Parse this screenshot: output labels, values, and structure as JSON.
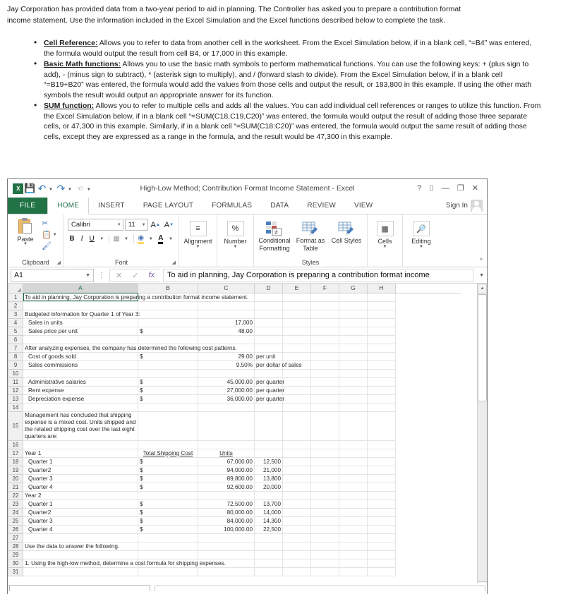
{
  "intro": {
    "p1": "Jay Corporation has provided data from a two-year period to aid in planning.  The Controller has asked you to prepare a contribution format",
    "p2": "income statement.  Use the information included in the Excel Simulation and the Excel functions described below to complete the task."
  },
  "bullets": [
    {
      "term": "Cell Reference:",
      "text": " Allows you to refer to data from another cell in the worksheet.  From the Excel Simulation below, if in a blank cell, “=B4” was entered, the formula would output the result from cell B4, or 17,000 in this example."
    },
    {
      "term": "Basic Math functions:",
      "text": " Allows you to use the basic math symbols to perform mathematical functions.  You can use the following keys:  + (plus sign to add), - (minus sign to subtract), * (asterisk sign to multiply), and / (forward slash to divide).  From the Excel Simulation below, if in a blank cell “=B19+B20” was entered, the formula would add the values from those cells and output the result, or 183,800 in this example.  If using the other math symbols the result would output an appropriate answer for its function."
    },
    {
      "term": "SUM function:",
      "text": " Allows you to refer to multiple cells and adds all the values.  You can add individual cell references or ranges to utilize this function.  From the Excel Simulation below, if in a blank cell “=SUM(C18,C19,C20)” was entered, the formula would output the result of adding those three separate cells, or 47,300 in this example.  Similarly, if in a blank cell “=SUM(C18:C20)” was entered, the formula would output the same result of adding those cells, except they are expressed as a range in the formula, and the result would be 47,300 in this example."
    }
  ],
  "excel": {
    "title": "High-Low Method; Contribution Format Income Statement - Excel",
    "logo_text": "X",
    "quick_access": [
      "save-icon",
      "undo-icon",
      "redo-icon",
      "touch-mode-icon",
      "qat-more-icon"
    ],
    "window_buttons": [
      "?",
      "⌷",
      "—",
      "❐",
      "✕"
    ],
    "sign_in": "Sign In",
    "tabs": [
      {
        "label": "FILE",
        "active": false
      },
      {
        "label": "HOME",
        "active": true
      },
      {
        "label": "INSERT",
        "active": false
      },
      {
        "label": "PAGE LAYOUT",
        "active": false
      },
      {
        "label": "FORMULAS",
        "active": false
      },
      {
        "label": "DATA",
        "active": false
      },
      {
        "label": "REVIEW",
        "active": false
      },
      {
        "label": "VIEW",
        "active": false
      }
    ],
    "ribbon": {
      "clipboard": {
        "group_label": "Clipboard",
        "paste_label": "Paste",
        "cut_label": "Cut",
        "copy_label": "Copy",
        "format_painter_label": "Format Painter"
      },
      "font": {
        "group_label": "Font",
        "font_name": "Calibri",
        "font_size": "11",
        "grow_label": "A",
        "shrink_label": "A",
        "bold": "B",
        "italic": "I",
        "underline": "U",
        "border_label": "Borders",
        "fill_label": "Fill Color",
        "font_color_label": "A"
      },
      "alignment": {
        "label": "Alignment"
      },
      "number": {
        "label": "Number",
        "glyph": "%"
      },
      "styles": {
        "group_label": "Styles",
        "conditional_formatting": "Conditional Formatting",
        "format_as_table": "Format as Table",
        "cell_styles": "Cell Styles"
      },
      "cells": {
        "label": "Cells"
      },
      "editing": {
        "label": "Editing"
      }
    },
    "formula_bar": {
      "name_box": "A1",
      "cancel_icon": "✕",
      "enter_icon": "✓",
      "function_icon": "fx",
      "formula": "To aid in planning, Jay Corporation is preparing a contribution format income"
    },
    "grid": {
      "columns": [
        "A",
        "B",
        "C",
        "D",
        "E",
        "F",
        "G",
        "H"
      ],
      "selected_cell": "A1",
      "rows": [
        {
          "n": "1",
          "a": "To aid in planning, Jay Corporation is preparing a contribution format income statement.",
          "bleed": true,
          "sel": true
        },
        {
          "n": "2",
          "a": ""
        },
        {
          "n": "3",
          "a": "Budgeted information for Quarter 1 of Year 3:",
          "bleed": true
        },
        {
          "n": "4",
          "a": "Sales in units",
          "indent": true,
          "c": "17,000",
          "cnum": true
        },
        {
          "n": "5",
          "a": "Sales price per unit",
          "indent": true,
          "b": "$",
          "c": "48.00",
          "cnum": true
        },
        {
          "n": "6",
          "a": ""
        },
        {
          "n": "7",
          "a": "After analyzing expenses, the company has determined the following cost patterns.",
          "bleed": true
        },
        {
          "n": "8",
          "a": "Cost of goods sold",
          "indent": true,
          "b": "$",
          "c": "29.00",
          "cnum": true,
          "d": "per unit",
          "dbleed": true
        },
        {
          "n": "9",
          "a": "Sales commissions",
          "indent": true,
          "c": "9.50%",
          "cnum": true,
          "d": "per dollar of sales",
          "dbleed": true
        },
        {
          "n": "10",
          "a": ""
        },
        {
          "n": "11",
          "a": "Administrative salaries",
          "indent": true,
          "b": "$",
          "c": "45,000.00",
          "cnum": true,
          "d": "per quarter",
          "dbleed": true
        },
        {
          "n": "12",
          "a": "Rent expense",
          "indent": true,
          "b": "$",
          "c": "27,000.00",
          "cnum": true,
          "d": "per quarter",
          "dbleed": true
        },
        {
          "n": "13",
          "a": "Depreciation expense",
          "indent": true,
          "b": "$",
          "c": "36,000.00",
          "cnum": true,
          "d": "per quarter",
          "dbleed": true
        },
        {
          "n": "14",
          "a": ""
        },
        {
          "n": "15",
          "a": "Management has concluded that shipping expense is a mixed cost. Units shipped and the related shipping cost over the last eight quarters are:",
          "wrap": true,
          "tall": true
        },
        {
          "n": "16",
          "a": ""
        },
        {
          "n": "17",
          "a": "Year 1",
          "b": "Total Shipping Cost",
          "bhead": true,
          "c": "Units",
          "chead": true
        },
        {
          "n": "18",
          "a": "Quarter 1",
          "indent": true,
          "b": "$",
          "c": "67,000.00",
          "cnum": true,
          "d": "12,500",
          "dnum": true
        },
        {
          "n": "19",
          "a": "Quarter2",
          "indent": true,
          "b": "$",
          "c": "94,000.00",
          "cnum": true,
          "d": "21,000",
          "dnum": true
        },
        {
          "n": "20",
          "a": "Quarter 3",
          "indent": true,
          "b": "$",
          "c": "89,800.00",
          "cnum": true,
          "d": "13,800",
          "dnum": true
        },
        {
          "n": "21",
          "a": "Quarter 4",
          "indent": true,
          "b": "$",
          "c": "92,600.00",
          "cnum": true,
          "d": "20,000",
          "dnum": true
        },
        {
          "n": "22",
          "a": "Year 2"
        },
        {
          "n": "23",
          "a": "Quarter 1",
          "indent": true,
          "b": "$",
          "c": "72,500.00",
          "cnum": true,
          "d": "13,700",
          "dnum": true
        },
        {
          "n": "24",
          "a": "Quarter2",
          "indent": true,
          "b": "$",
          "c": "80,000.00",
          "cnum": true,
          "d": "14,000",
          "dnum": true
        },
        {
          "n": "25",
          "a": "Quarter 3",
          "indent": true,
          "b": "$",
          "c": "84,000.00",
          "cnum": true,
          "d": "14,300",
          "dnum": true
        },
        {
          "n": "26",
          "a": "Quarter 4",
          "indent": true,
          "b": "$",
          "c": "100,000.00",
          "cnum": true,
          "d": "22,500",
          "dnum": true
        },
        {
          "n": "27",
          "a": ""
        },
        {
          "n": "28",
          "a": "Use the data to answer the following.",
          "bleed": true
        },
        {
          "n": "29",
          "a": ""
        },
        {
          "n": "30",
          "a": "1. Using the high-low method, determine a cost formula for shipping expenses.",
          "bleed": true
        },
        {
          "n": "31",
          "a": ""
        }
      ]
    }
  },
  "colors": {
    "excel_green": "#217346",
    "accent_blue": "#2e75b6",
    "selection_green": "#1b6b3f"
  }
}
